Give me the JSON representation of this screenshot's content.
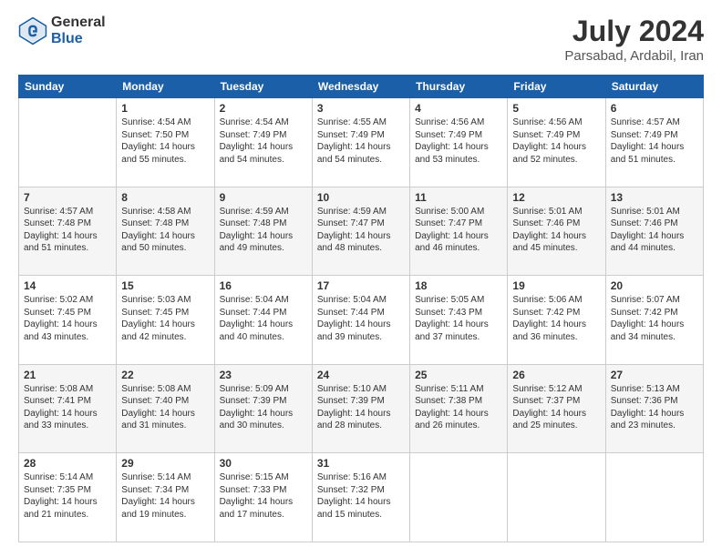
{
  "header": {
    "logo_line1": "General",
    "logo_line2": "Blue",
    "month_year": "July 2024",
    "location": "Parsabad, Ardabil, Iran"
  },
  "days_of_week": [
    "Sunday",
    "Monday",
    "Tuesday",
    "Wednesday",
    "Thursday",
    "Friday",
    "Saturday"
  ],
  "weeks": [
    [
      {
        "day": "",
        "info": ""
      },
      {
        "day": "1",
        "info": "Sunrise: 4:54 AM\nSunset: 7:50 PM\nDaylight: 14 hours\nand 55 minutes."
      },
      {
        "day": "2",
        "info": "Sunrise: 4:54 AM\nSunset: 7:49 PM\nDaylight: 14 hours\nand 54 minutes."
      },
      {
        "day": "3",
        "info": "Sunrise: 4:55 AM\nSunset: 7:49 PM\nDaylight: 14 hours\nand 54 minutes."
      },
      {
        "day": "4",
        "info": "Sunrise: 4:56 AM\nSunset: 7:49 PM\nDaylight: 14 hours\nand 53 minutes."
      },
      {
        "day": "5",
        "info": "Sunrise: 4:56 AM\nSunset: 7:49 PM\nDaylight: 14 hours\nand 52 minutes."
      },
      {
        "day": "6",
        "info": "Sunrise: 4:57 AM\nSunset: 7:49 PM\nDaylight: 14 hours\nand 51 minutes."
      }
    ],
    [
      {
        "day": "7",
        "info": "Sunrise: 4:57 AM\nSunset: 7:48 PM\nDaylight: 14 hours\nand 51 minutes."
      },
      {
        "day": "8",
        "info": "Sunrise: 4:58 AM\nSunset: 7:48 PM\nDaylight: 14 hours\nand 50 minutes."
      },
      {
        "day": "9",
        "info": "Sunrise: 4:59 AM\nSunset: 7:48 PM\nDaylight: 14 hours\nand 49 minutes."
      },
      {
        "day": "10",
        "info": "Sunrise: 4:59 AM\nSunset: 7:47 PM\nDaylight: 14 hours\nand 48 minutes."
      },
      {
        "day": "11",
        "info": "Sunrise: 5:00 AM\nSunset: 7:47 PM\nDaylight: 14 hours\nand 46 minutes."
      },
      {
        "day": "12",
        "info": "Sunrise: 5:01 AM\nSunset: 7:46 PM\nDaylight: 14 hours\nand 45 minutes."
      },
      {
        "day": "13",
        "info": "Sunrise: 5:01 AM\nSunset: 7:46 PM\nDaylight: 14 hours\nand 44 minutes."
      }
    ],
    [
      {
        "day": "14",
        "info": "Sunrise: 5:02 AM\nSunset: 7:45 PM\nDaylight: 14 hours\nand 43 minutes."
      },
      {
        "day": "15",
        "info": "Sunrise: 5:03 AM\nSunset: 7:45 PM\nDaylight: 14 hours\nand 42 minutes."
      },
      {
        "day": "16",
        "info": "Sunrise: 5:04 AM\nSunset: 7:44 PM\nDaylight: 14 hours\nand 40 minutes."
      },
      {
        "day": "17",
        "info": "Sunrise: 5:04 AM\nSunset: 7:44 PM\nDaylight: 14 hours\nand 39 minutes."
      },
      {
        "day": "18",
        "info": "Sunrise: 5:05 AM\nSunset: 7:43 PM\nDaylight: 14 hours\nand 37 minutes."
      },
      {
        "day": "19",
        "info": "Sunrise: 5:06 AM\nSunset: 7:42 PM\nDaylight: 14 hours\nand 36 minutes."
      },
      {
        "day": "20",
        "info": "Sunrise: 5:07 AM\nSunset: 7:42 PM\nDaylight: 14 hours\nand 34 minutes."
      }
    ],
    [
      {
        "day": "21",
        "info": "Sunrise: 5:08 AM\nSunset: 7:41 PM\nDaylight: 14 hours\nand 33 minutes."
      },
      {
        "day": "22",
        "info": "Sunrise: 5:08 AM\nSunset: 7:40 PM\nDaylight: 14 hours\nand 31 minutes."
      },
      {
        "day": "23",
        "info": "Sunrise: 5:09 AM\nSunset: 7:39 PM\nDaylight: 14 hours\nand 30 minutes."
      },
      {
        "day": "24",
        "info": "Sunrise: 5:10 AM\nSunset: 7:39 PM\nDaylight: 14 hours\nand 28 minutes."
      },
      {
        "day": "25",
        "info": "Sunrise: 5:11 AM\nSunset: 7:38 PM\nDaylight: 14 hours\nand 26 minutes."
      },
      {
        "day": "26",
        "info": "Sunrise: 5:12 AM\nSunset: 7:37 PM\nDaylight: 14 hours\nand 25 minutes."
      },
      {
        "day": "27",
        "info": "Sunrise: 5:13 AM\nSunset: 7:36 PM\nDaylight: 14 hours\nand 23 minutes."
      }
    ],
    [
      {
        "day": "28",
        "info": "Sunrise: 5:14 AM\nSunset: 7:35 PM\nDaylight: 14 hours\nand 21 minutes."
      },
      {
        "day": "29",
        "info": "Sunrise: 5:14 AM\nSunset: 7:34 PM\nDaylight: 14 hours\nand 19 minutes."
      },
      {
        "day": "30",
        "info": "Sunrise: 5:15 AM\nSunset: 7:33 PM\nDaylight: 14 hours\nand 17 minutes."
      },
      {
        "day": "31",
        "info": "Sunrise: 5:16 AM\nSunset: 7:32 PM\nDaylight: 14 hours\nand 15 minutes."
      },
      {
        "day": "",
        "info": ""
      },
      {
        "day": "",
        "info": ""
      },
      {
        "day": "",
        "info": ""
      }
    ]
  ]
}
